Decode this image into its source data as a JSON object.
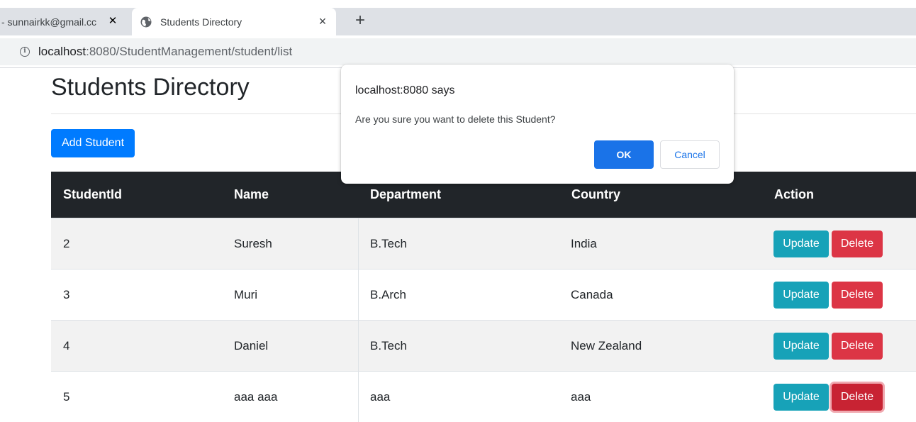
{
  "browser": {
    "tabs": [
      {
        "title": "- sunnairkk@gmail.cc",
        "close": "✕"
      },
      {
        "title": "Students Directory",
        "close": "×"
      }
    ],
    "new_tab": "+",
    "url_host": "localhost",
    "url_path": ":8080/StudentManagement/student/list"
  },
  "page": {
    "title": "Students Directory",
    "add_button": "Add Student"
  },
  "table": {
    "headers": [
      "StudentId",
      "Name",
      "Department",
      "Country",
      "Action"
    ],
    "rows": [
      {
        "id": "2",
        "name": "Suresh",
        "department": "B.Tech",
        "country": "India"
      },
      {
        "id": "3",
        "name": "Muri",
        "department": "B.Arch",
        "country": "Canada"
      },
      {
        "id": "4",
        "name": "Daniel",
        "department": "B.Tech",
        "country": "New Zealand"
      },
      {
        "id": "5",
        "name": "aaa aaa",
        "department": "aaa",
        "country": "aaa"
      }
    ],
    "update_label": "Update",
    "delete_label": "Delete"
  },
  "dialog": {
    "title": "localhost:8080 says",
    "message": "Are you sure you want to delete this Student?",
    "ok": "OK",
    "cancel": "Cancel"
  },
  "colors": {
    "primary": "#007bff",
    "info": "#17a2b8",
    "danger": "#dc3545",
    "table_header": "#212529",
    "dialog_ok": "#1a73e8"
  }
}
